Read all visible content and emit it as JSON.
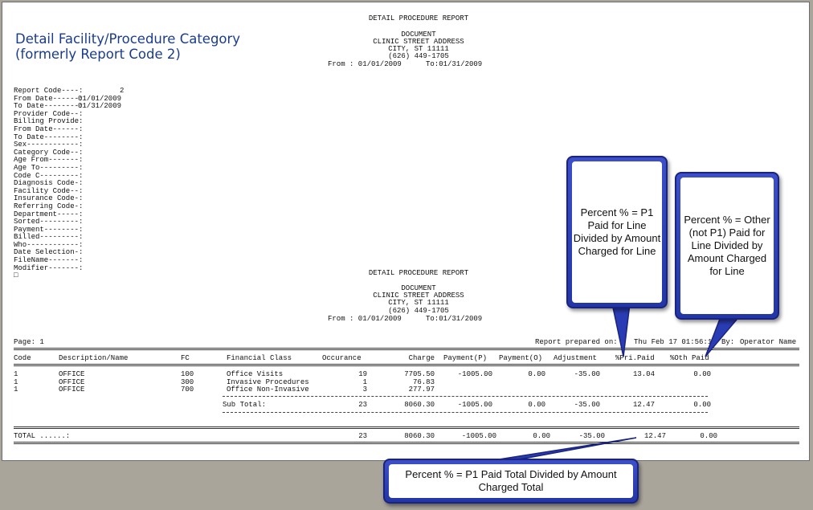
{
  "heading": {
    "line1": "Detail Facility/Procedure Category",
    "line2": "(formerly Report Code 2)"
  },
  "report_header_top": {
    "title": "DETAIL PROCEDURE REPORT",
    "doc": "DOCUMENT",
    "address": "CLINIC STREET ADDRESS",
    "city": "CITY, ST 11111",
    "phone": "(626) 449-1705",
    "from_label": "From : 01/01/2009",
    "to_label": "To:01/31/2009"
  },
  "criteria": [
    {
      "label": "Report Code----:",
      "value": "2"
    },
    {
      "label": "From Date------:",
      "value": "01/01/2009"
    },
    {
      "label": "To Date--------:",
      "value": "01/31/2009"
    },
    {
      "label": "Provider Code--:",
      "value": ""
    },
    {
      "label": "Billing Provide:",
      "value": ""
    },
    {
      "label": "From Date------:",
      "value": ""
    },
    {
      "label": "To Date--------:",
      "value": ""
    },
    {
      "label": "Sex------------:",
      "value": ""
    },
    {
      "label": "Category Code--:",
      "value": ""
    },
    {
      "label": "Age From-------:",
      "value": ""
    },
    {
      "label": "Age To---------:",
      "value": ""
    },
    {
      "label": "Code C---------:",
      "value": ""
    },
    {
      "label": "Diagnosis Code-:",
      "value": ""
    },
    {
      "label": "Facility Code--:",
      "value": ""
    },
    {
      "label": "Insurance Code-:",
      "value": ""
    },
    {
      "label": "Referring Code-:",
      "value": ""
    },
    {
      "label": "Department-----:",
      "value": ""
    },
    {
      "label": "Sorted---------:",
      "value": ""
    },
    {
      "label": "Payment--------:",
      "value": ""
    },
    {
      "label": "Billed---------:",
      "value": ""
    },
    {
      "label": "Who------------:",
      "value": ""
    },
    {
      "label": "Date Selection-:",
      "value": ""
    },
    {
      "label": "FileName-------:",
      "value": ""
    },
    {
      "label": "Modifier-------:",
      "value": ""
    },
    {
      "label": "□",
      "value": ""
    }
  ],
  "report_header_bottom": {
    "title": "DETAIL PROCEDURE REPORT",
    "doc": "DOCUMENT",
    "address": "CLINIC STREET ADDRESS",
    "city": "CITY, ST 11111",
    "phone": "(626) 449-1705",
    "from_label": "From : 01/01/2009",
    "to_label": "To:01/31/2009"
  },
  "page_line": {
    "page": "Page: 1",
    "prepared_prefix": "Report prepared on:",
    "prepared_value": "Thu Feb 17 01:56:1",
    "by_prefix": "By:",
    "operator": "Operator Name"
  },
  "table": {
    "headers": {
      "code": "Code",
      "desc": "Description/Name",
      "fc": "FC",
      "fin": "Financial Class",
      "occ": "Occurance",
      "charge": "Charge",
      "payp": "Payment(P)",
      "payo": "Payment(O)",
      "adj": "Adjustment",
      "pri": "%Pri.Paid",
      "oth": "%Oth Paid"
    },
    "rows": [
      {
        "code": "1",
        "desc": "OFFICE",
        "fc": "100",
        "fin": "Office Visits",
        "occ": "19",
        "charge": "7705.50",
        "payp": "-1005.00",
        "payo": "0.00",
        "adj": "-35.00",
        "pri": "13.04",
        "oth": "0.00"
      },
      {
        "code": "1",
        "desc": "OFFICE",
        "fc": "300",
        "fin": "Invasive Procedures",
        "occ": "1",
        "charge": "76.83",
        "payp": "",
        "payo": "",
        "adj": "",
        "pri": "",
        "oth": ""
      },
      {
        "code": "1",
        "desc": "OFFICE",
        "fc": "700",
        "fin": "Office Non-Invasive",
        "occ": "3",
        "charge": "277.97",
        "payp": "",
        "payo": "",
        "adj": "",
        "pri": "",
        "oth": ""
      }
    ],
    "subtotal": {
      "label": "Sub Total:",
      "occ": "23",
      "charge": "8060.30",
      "payp": "-1005.00",
      "payo": "0.00",
      "adj": "-35.00",
      "pri": "12.47",
      "oth": "0.00"
    },
    "total": {
      "label": "TOTAL ......:",
      "occ": "23",
      "charge": "8060.30",
      "payp": "-1005.00",
      "payo": "0.00",
      "adj": "-35.00",
      "pri": "12.47",
      "oth": "0.00"
    }
  },
  "callouts": {
    "pri": "Percent % = P1 Paid for Line Divided by Amount Charged for Line",
    "oth": "Percent % = Other (not P1) Paid for Line Divided by Amount Charged for Line",
    "total": "Percent % = P1 Paid Total Divided by Amount Charged Total"
  },
  "colors": {
    "heading": "#1a3c8f",
    "callout_border": "#2336a6",
    "background": "#a9a59b"
  }
}
